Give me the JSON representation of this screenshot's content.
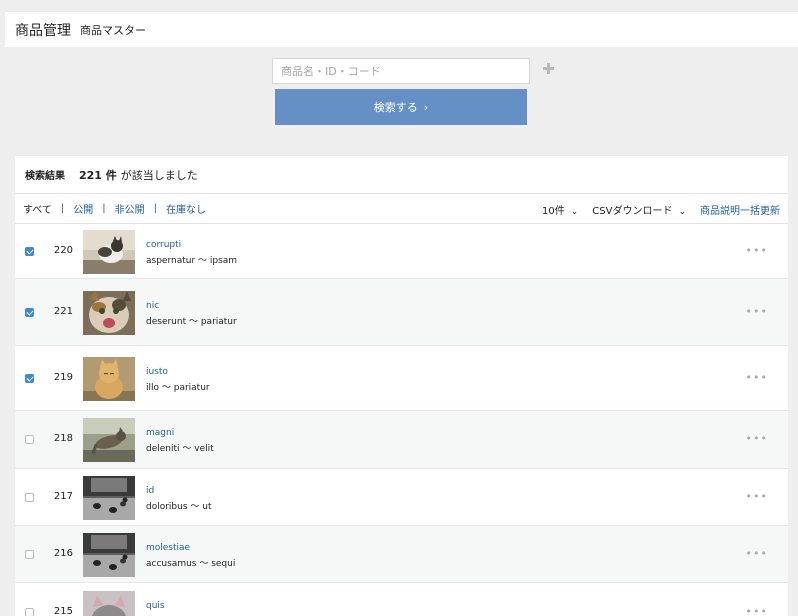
{
  "header": {
    "title": "商品管理",
    "subtitle": "商品マスター"
  },
  "search": {
    "placeholder": "商品名・ID・コード",
    "button_label": "検索する",
    "button_chevron": "›"
  },
  "results": {
    "label": "検索結果",
    "count": "221 件",
    "message": "が該当しました",
    "filters": [
      "すべて",
      "公開",
      "非公開",
      "在庫なし"
    ],
    "separator": "|",
    "per_page": "10件",
    "csv_download": "CSVダウンロード",
    "bulk_edit": "商品説明一括更新",
    "dropdown_chevron": "⌄",
    "more_icon": "•••"
  },
  "products": [
    {
      "checked": true,
      "id": "220",
      "name": "corrupti",
      "desc": "aspernatur 〜 ipsam",
      "thumb": "cat-on-railing"
    },
    {
      "checked": true,
      "id": "221",
      "name": "nic",
      "desc": "deserunt 〜 pariatur",
      "thumb": "kitten-meowing"
    },
    {
      "checked": true,
      "id": "219",
      "name": "iusto",
      "desc": "illo 〜 pariatur",
      "thumb": "ginger-cat-sitting"
    },
    {
      "checked": false,
      "id": "218",
      "name": "magni",
      "desc": "deleniti 〜 velit",
      "thumb": "cat-jumping"
    },
    {
      "checked": false,
      "id": "217",
      "name": "id",
      "desc": "doloribus 〜 ut",
      "thumb": "cats-in-alley"
    },
    {
      "checked": false,
      "id": "216",
      "name": "molestiae",
      "desc": "accusamus 〜 sequi",
      "thumb": "cats-in-alley"
    },
    {
      "checked": false,
      "id": "215",
      "name": "quis",
      "desc": "",
      "thumb": "grey-cat"
    }
  ],
  "colors": {
    "accent": "#6590c6",
    "link": "#1e5e99",
    "checkbox": "#3f87d8"
  }
}
